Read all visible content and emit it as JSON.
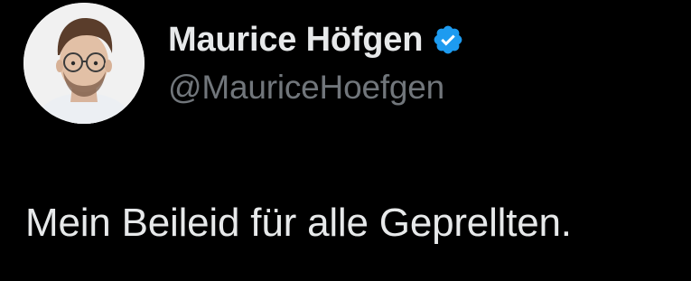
{
  "author": {
    "display_name": "Maurice Höfgen",
    "handle": "@MauriceHoefgen",
    "verified": true
  },
  "tweet": {
    "text": "Mein Beileid für alle Geprellten."
  },
  "colors": {
    "background": "#000000",
    "primary_text": "#e7e9ea",
    "secondary_text": "#71767b",
    "verified_badge": "#1d9bf0"
  },
  "icons": {
    "verified": "verified-badge-icon",
    "avatar": "profile-photo"
  }
}
